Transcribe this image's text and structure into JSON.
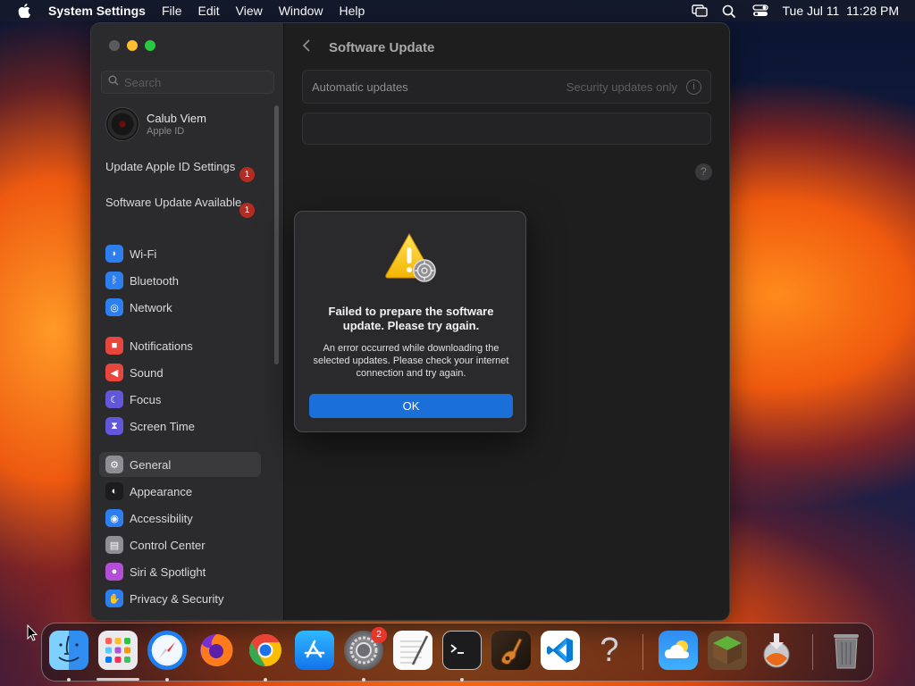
{
  "menubar": {
    "app_name": "System Settings",
    "menus": [
      "File",
      "Edit",
      "View",
      "Window",
      "Help"
    ],
    "datetime": "Tue Jul 11  11:28 PM"
  },
  "sidebar": {
    "search_placeholder": "Search",
    "profile": {
      "name": "Calub Viem",
      "subtitle": "Apple ID"
    },
    "notices": [
      {
        "label": "Update Apple ID Settings",
        "badge": "1"
      },
      {
        "label": "Software Update Available",
        "badge": "1"
      }
    ],
    "groups": [
      [
        {
          "label": "Wi-Fi",
          "icon": "wifi-icon",
          "color": "#2d7ff0"
        },
        {
          "label": "Bluetooth",
          "icon": "bluetooth-icon",
          "color": "#2d7ff0"
        },
        {
          "label": "Network",
          "icon": "globe-icon",
          "color": "#2d7ff0"
        }
      ],
      [
        {
          "label": "Notifications",
          "icon": "bell-icon",
          "color": "#e8453c"
        },
        {
          "label": "Sound",
          "icon": "speaker-icon",
          "color": "#e8453c"
        },
        {
          "label": "Focus",
          "icon": "moon-icon",
          "color": "#6256d9"
        },
        {
          "label": "Screen Time",
          "icon": "hourglass-icon",
          "color": "#6256d9"
        }
      ],
      [
        {
          "label": "General",
          "icon": "gear-icon",
          "color": "#8e8e93",
          "selected": true
        },
        {
          "label": "Appearance",
          "icon": "appearance-icon",
          "color": "#1c1c1e"
        },
        {
          "label": "Accessibility",
          "icon": "accessibility-icon",
          "color": "#2d7ff0"
        },
        {
          "label": "Control Center",
          "icon": "control-center-icon",
          "color": "#8e8e93"
        },
        {
          "label": "Siri & Spotlight",
          "icon": "siri-icon",
          "color": "#b34fd6"
        },
        {
          "label": "Privacy & Security",
          "icon": "hand-icon",
          "color": "#2d7ff0"
        }
      ]
    ]
  },
  "main": {
    "title": "Software Update",
    "automatic_updates_label": "Automatic updates",
    "automatic_updates_value": "Security updates only",
    "help": "?"
  },
  "dialog": {
    "title": "Failed to prepare the software update. Please try again.",
    "message": "An error occurred while downloading the selected updates. Please check your internet connection and try again.",
    "ok_label": "OK"
  },
  "dock": {
    "apps": [
      {
        "name": "Finder",
        "icon": "finder-icon",
        "running": true
      },
      {
        "name": "Launchpad",
        "icon": "launchpad-icon",
        "running": false
      },
      {
        "name": "Safari",
        "icon": "safari-icon",
        "running": true
      },
      {
        "name": "Firefox",
        "icon": "firefox-icon",
        "running": false
      },
      {
        "name": "Chrome",
        "icon": "chrome-icon",
        "running": true
      },
      {
        "name": "App Store",
        "icon": "app-store-icon",
        "running": false
      },
      {
        "name": "System Settings",
        "icon": "system-settings-icon",
        "running": true,
        "badge": "2"
      },
      {
        "name": "TextEdit",
        "icon": "textedit-icon",
        "running": false
      },
      {
        "name": "Terminal",
        "icon": "terminal-icon",
        "running": true
      },
      {
        "name": "GarageBand",
        "icon": "garageband-icon",
        "running": false
      },
      {
        "name": "Visual Studio Code",
        "icon": "vscode-icon",
        "running": false
      },
      {
        "name": "Unknown",
        "icon": "question-mark-icon",
        "running": false
      },
      {
        "name": "Weather",
        "icon": "weather-icon",
        "running": false
      },
      {
        "name": "Minecraft",
        "icon": "minecraft-icon",
        "running": false
      },
      {
        "name": "macOS Installer",
        "icon": "installer-icon",
        "running": false
      },
      {
        "name": "Trash",
        "icon": "trash-icon",
        "running": false
      }
    ]
  }
}
